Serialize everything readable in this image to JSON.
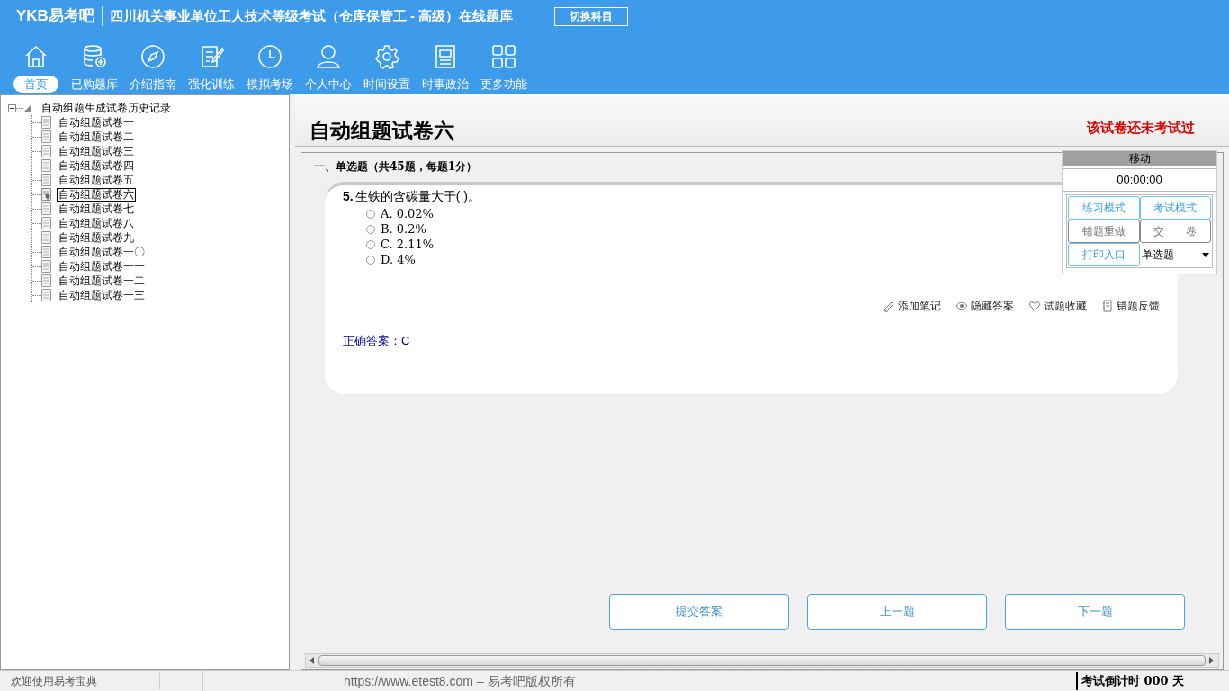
{
  "header": {
    "logo": "YKB易考吧",
    "title": "四川机关事业单位工人技术等级考试（仓库保管工 - 高级）在线题库",
    "switch_button": "切换科目"
  },
  "nav": [
    {
      "label": "首页",
      "kind": "home",
      "selected": true
    },
    {
      "label": "已购题库",
      "kind": "database",
      "selected": false
    },
    {
      "label": "介绍指南",
      "kind": "compass",
      "selected": false
    },
    {
      "label": "强化训练",
      "kind": "edit",
      "selected": false
    },
    {
      "label": "模拟考场",
      "kind": "clock",
      "selected": false
    },
    {
      "label": "个人中心",
      "kind": "user",
      "selected": false
    },
    {
      "label": "时间设置",
      "kind": "gear",
      "selected": false
    },
    {
      "label": "时事政治",
      "kind": "news",
      "selected": false
    },
    {
      "label": "更多功能",
      "kind": "grid",
      "selected": false
    }
  ],
  "tree": {
    "label": "自动组题生成试卷历史记录",
    "expanded": true,
    "children": [
      {
        "label": "自动组题试卷一",
        "selected": false
      },
      {
        "label": "自动组题试卷二",
        "selected": false
      },
      {
        "label": "自动组题试卷三",
        "selected": false
      },
      {
        "label": "自动组题试卷四",
        "selected": false
      },
      {
        "label": "自动组题试卷五",
        "selected": false
      },
      {
        "label": "自动组题试卷六",
        "selected": true
      },
      {
        "label": "自动组题试卷七",
        "selected": false
      },
      {
        "label": "自动组题试卷八",
        "selected": false
      },
      {
        "label": "自动组题试卷九",
        "selected": false
      },
      {
        "label": "自动组题试卷一〇",
        "selected": false
      },
      {
        "label": "自动组题试卷一一",
        "selected": false
      },
      {
        "label": "自动组题试卷一二",
        "selected": false
      },
      {
        "label": "自动组题试卷一三",
        "selected": false
      }
    ]
  },
  "paper": {
    "title": "自动组题试卷六",
    "status": "该试卷还未考试过",
    "section": "一、单选题（共45题，每题1分）",
    "question": {
      "number": "5.",
      "text": "生铁的含碳量大于( )。",
      "options": [
        {
          "label": "A. 0.02%",
          "checked": false
        },
        {
          "label": "B. 0.2%",
          "checked": false
        },
        {
          "label": "C. 2.11%",
          "checked": false
        },
        {
          "label": "D. 4%",
          "checked": false
        }
      ],
      "actions": [
        {
          "label": "添加笔记",
          "kind": "pencil"
        },
        {
          "label": "隐藏答案",
          "kind": "eye"
        },
        {
          "label": "试题收藏",
          "kind": "heart"
        },
        {
          "label": "错题反馈",
          "kind": "book"
        }
      ],
      "answer": "正确答案：C"
    },
    "buttons": [
      "提交答案",
      "上一题",
      "下一题"
    ]
  },
  "panel": {
    "header": "移动",
    "timer": "00:00:00",
    "buttons": [
      {
        "label": "练习模式",
        "kind": "blue"
      },
      {
        "label": "考试模式",
        "kind": "blue"
      },
      {
        "label": "错题重做",
        "kind": "gray"
      },
      {
        "label": "交　　卷",
        "kind": "gray"
      },
      {
        "label": "打印入口",
        "kind": "blue"
      }
    ],
    "select": "单选题"
  },
  "status_bar": {
    "welcome": "欢迎使用易考宝典",
    "copyright": "https://www.etest8.com – 易考吧版权所有",
    "countdown": "考试倒计时 000 天"
  }
}
